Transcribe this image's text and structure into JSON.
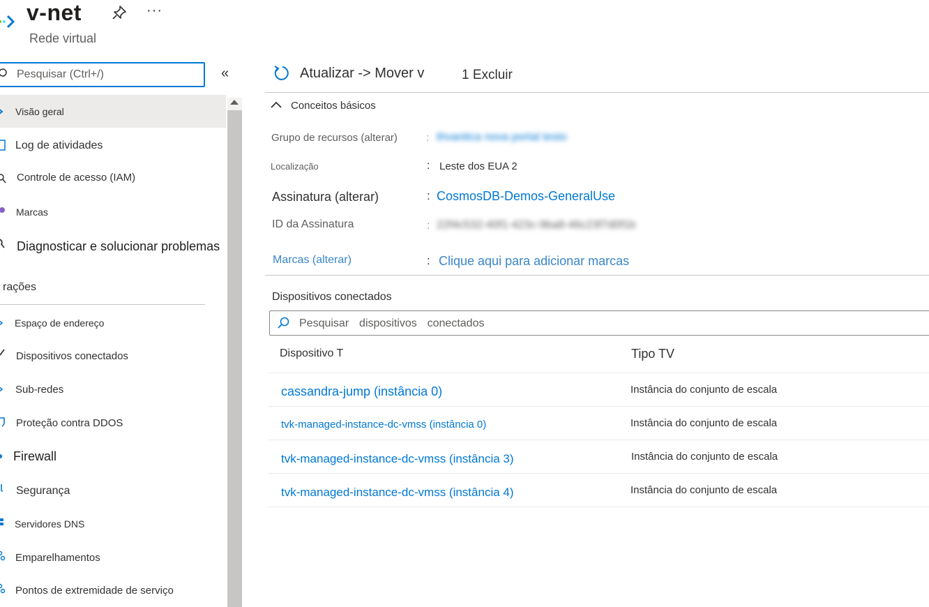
{
  "header": {
    "title": "v-net",
    "subtitle": "Rede virtual",
    "more_label": "···",
    "icons": {
      "resource": "vnet-icon",
      "pin": "pin-icon",
      "more": "ellipsis-icon"
    }
  },
  "sidebar": {
    "search_placeholder": "Pesquisar (Ctrl+/)",
    "collapse_label": "«",
    "items": [
      {
        "label": "Visão geral",
        "icon": "overview-icon",
        "selected": true
      },
      {
        "label": "Log de atividades",
        "icon": "activity-log-icon"
      },
      {
        "label": "Controle de acesso (IAM)",
        "icon": "access-control-icon"
      },
      {
        "label": "Marcas",
        "icon": "tag-icon"
      },
      {
        "label": "Diagnosticar e solucionar problemas",
        "icon": "wrench-icon"
      }
    ],
    "section_label": "rações",
    "section_items": [
      {
        "label": "Espaço de endereço",
        "icon": "address-space-icon"
      },
      {
        "label": "Dispositivos conectados",
        "icon": "connected-devices-icon"
      },
      {
        "label": "Sub-redes",
        "icon": "subnets-icon"
      },
      {
        "label": "Proteção contra DDOS",
        "icon": "shield-icon"
      },
      {
        "label": "Firewall",
        "icon": "firewall-icon"
      },
      {
        "label": "Segurança",
        "icon": "security-icon"
      },
      {
        "label": "Servidores DNS",
        "icon": "dns-icon"
      },
      {
        "label": "Emparelhamentos",
        "icon": "peering-icon"
      },
      {
        "label": "Pontos de extremidade de serviço",
        "icon": "service-endpoint-icon"
      }
    ]
  },
  "toolbar": {
    "refresh_label": "Atualizar -> Mover v",
    "delete_label": "1 Excluir"
  },
  "essentials": {
    "header": "Conceitos básicos",
    "properties": [
      {
        "label": "Grupo de recursos (alterar)",
        "value": "thvantica nova portal testo",
        "link": true,
        "blurred": true
      },
      {
        "label": "Localização",
        "value": "Leste dos EUA 2",
        "link": false,
        "blurred": false
      },
      {
        "label": "Assinatura (alterar)",
        "value": "CosmosDB-Demos-GeneralUse",
        "link": true,
        "blurred": false
      },
      {
        "label": "ID da Assinatura",
        "value": "22f4c532-40f1-423c-9ba8-46c23f7d0f1b",
        "link": false,
        "blurred": true
      },
      {
        "label": "Marcas (alterar)",
        "value": "Clique aqui para adicionar marcas",
        "link": true,
        "blurred": false
      }
    ]
  },
  "devices": {
    "title": "Dispositivos conectados",
    "search_placeholder": "Pesquisar  dispositivos  conectados",
    "columns": {
      "device": "Dispositivo T",
      "type": "Tipo TV"
    },
    "rows": [
      {
        "device": "cassandra-jump (instância 0)",
        "type": "Instância do conjunto de escala"
      },
      {
        "device": "tvk-managed-instance-dc-vmss  (instância  0)",
        "type": "Instância do conjunto de escala"
      },
      {
        "device": "tvk-managed-instance-dc-vmss (instância 3)",
        "type": "Instância do conjunto de escala"
      },
      {
        "device": "tvk-managed-instance-dc-vmss (instância 4)",
        "type": "Instância do conjunto de escala"
      }
    ]
  },
  "colors": {
    "accent": "#0078d4",
    "selected_bg": "#edebe9",
    "text": "#323130",
    "muted": "#605e5c"
  }
}
